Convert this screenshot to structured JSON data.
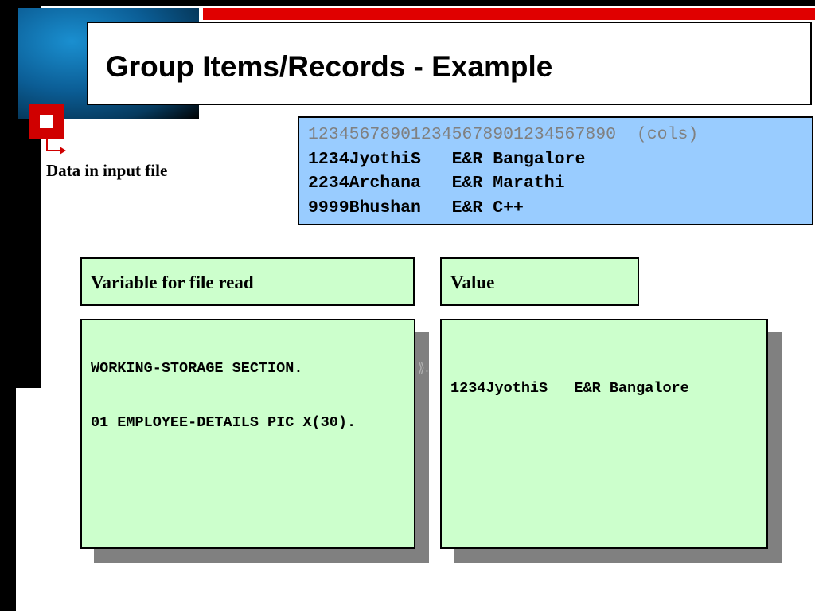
{
  "slide": {
    "title": "Group Items/Records - Example",
    "bullet_label": "Data in input file"
  },
  "input_file": {
    "ruler": "123456789012345678901234567890  (cols)",
    "records": [
      "1234JyothiS   E&R Bangalore",
      "2234Archana   E&R Marathi",
      "9999Bhushan   E&R C++"
    ]
  },
  "variable_panel": {
    "header": "Variable for file read",
    "code_lines": [
      "WORKING-STORAGE SECTION.",
      "01 EMPLOYEE-DETAILS PIC X(30)."
    ]
  },
  "value_panel": {
    "header": "Value",
    "value": "1234JyothiS   E&R Bangalore"
  },
  "colors": {
    "accent_red": "#e00000",
    "data_box_blue": "#99ccff",
    "panel_green": "#ccffcc",
    "shadow_gray": "#808080",
    "ruler_gray": "#808080"
  },
  "icons": [
    "bullet-square-icon",
    "corner-arrow-icon"
  ]
}
